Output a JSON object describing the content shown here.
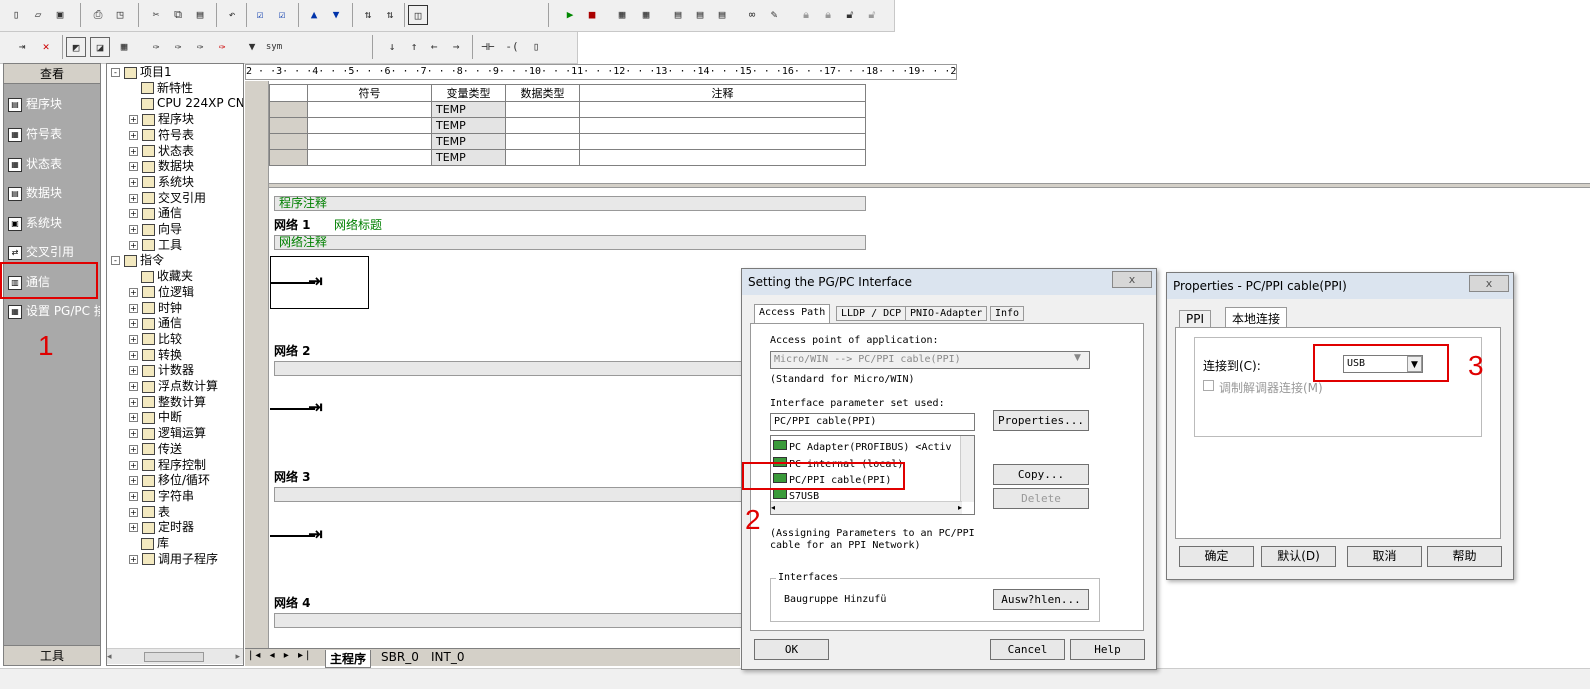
{
  "toolbar1_icons": [
    "new-icon",
    "open-icon",
    "save-icon",
    "print-icon",
    "print-preview-icon",
    "cut-icon",
    "copy-icon",
    "paste-icon",
    "undo-icon",
    "compile-icon",
    "compile-all-icon",
    "upload-icon",
    "download-icon",
    "sort-asc-icon",
    "sort-desc-icon",
    "options-icon",
    "run-icon",
    "stop-icon"
  ],
  "nav": {
    "header": "查看",
    "footer": "工具",
    "items": [
      {
        "label": "程序块",
        "icon": "program-block-icon"
      },
      {
        "label": "符号表",
        "icon": "symbol-table-icon"
      },
      {
        "label": "状态表",
        "icon": "status-table-icon"
      },
      {
        "label": "数据块",
        "icon": "data-block-icon"
      },
      {
        "label": "系统块",
        "icon": "system-block-icon"
      },
      {
        "label": "交叉引用",
        "icon": "cross-ref-icon"
      },
      {
        "label": "通信",
        "icon": "communication-icon"
      },
      {
        "label": "设置 PG/PC 接",
        "icon": "pgpc-icon"
      }
    ]
  },
  "tree": {
    "rows": [
      {
        "label": "项目1",
        "indent": 0,
        "pm": "-"
      },
      {
        "label": "新特性",
        "indent": 2,
        "pm": ""
      },
      {
        "label": "CPU 224XP CN",
        "indent": 2,
        "pm": ""
      },
      {
        "label": "程序块",
        "indent": 1,
        "pm": "+"
      },
      {
        "label": "符号表",
        "indent": 1,
        "pm": "+"
      },
      {
        "label": "状态表",
        "indent": 1,
        "pm": "+"
      },
      {
        "label": "数据块",
        "indent": 1,
        "pm": "+"
      },
      {
        "label": "系统块",
        "indent": 1,
        "pm": "+"
      },
      {
        "label": "交叉引用",
        "indent": 1,
        "pm": "+"
      },
      {
        "label": "通信",
        "indent": 1,
        "pm": "+"
      },
      {
        "label": "向导",
        "indent": 1,
        "pm": "+"
      },
      {
        "label": "工具",
        "indent": 1,
        "pm": "+"
      },
      {
        "label": "指令",
        "indent": 0,
        "pm": "-"
      },
      {
        "label": "收藏夹",
        "indent": 2,
        "pm": ""
      },
      {
        "label": "位逻辑",
        "indent": 1,
        "pm": "+"
      },
      {
        "label": "时钟",
        "indent": 1,
        "pm": "+"
      },
      {
        "label": "通信",
        "indent": 1,
        "pm": "+"
      },
      {
        "label": "比较",
        "indent": 1,
        "pm": "+"
      },
      {
        "label": "转换",
        "indent": 1,
        "pm": "+"
      },
      {
        "label": "计数器",
        "indent": 1,
        "pm": "+"
      },
      {
        "label": "浮点数计算",
        "indent": 1,
        "pm": "+"
      },
      {
        "label": "整数计算",
        "indent": 1,
        "pm": "+"
      },
      {
        "label": "中断",
        "indent": 1,
        "pm": "+"
      },
      {
        "label": "逻辑运算",
        "indent": 1,
        "pm": "+"
      },
      {
        "label": "传送",
        "indent": 1,
        "pm": "+"
      },
      {
        "label": "程序控制",
        "indent": 1,
        "pm": "+"
      },
      {
        "label": "移位/循环",
        "indent": 1,
        "pm": "+"
      },
      {
        "label": "字符串",
        "indent": 1,
        "pm": "+"
      },
      {
        "label": "表",
        "indent": 1,
        "pm": "+"
      },
      {
        "label": "定时器",
        "indent": 1,
        "pm": "+"
      },
      {
        "label": "库",
        "indent": 2,
        "pm": ""
      },
      {
        "label": "调用子程序",
        "indent": 1,
        "pm": "+"
      }
    ]
  },
  "ruler": "2 · ·3· · ·4· · ·5· · ·6· · ·7· · ·8· · ·9· · ·10· · ·11· · ·12· · ·13· · ·14· · ·15· · ·16· · ·17· · ·18· ·  ·19· · ·20· ·",
  "var_table": {
    "headers": [
      "符号",
      "变量类型",
      "数据类型",
      "注释"
    ],
    "rows": [
      [
        "",
        "TEMP",
        "",
        ""
      ],
      [
        "",
        "TEMP",
        "",
        ""
      ],
      [
        "",
        "TEMP",
        "",
        ""
      ],
      [
        "",
        "TEMP",
        "",
        ""
      ]
    ]
  },
  "editor": {
    "program_comment": "程序注释",
    "network1": "网络 1",
    "network_title": "网络标题",
    "network_comment": "网络注释",
    "network2": "网络 2",
    "network3": "网络 3",
    "network4": "网络 4"
  },
  "bottom_tabs": [
    "主程序",
    "SBR_0",
    "INT_0"
  ],
  "pgpc": {
    "title": "Setting the PG/PC Interface",
    "close": "x",
    "tabs": [
      "Access Path",
      "LLDP / DCP",
      "PNIO-Adapter",
      "Info"
    ],
    "ap_label": "Access point of application:",
    "ap_value": "Micro/WIN      --> PC/PPI cable(PPI)",
    "ap_note": "(Standard for Micro/WIN)",
    "ips_label": "Interface parameter set used:",
    "ips_value": "PC/PPI cable(PPI)",
    "properties": "Properties...",
    "list": [
      "PC Adapter(PROFIBUS)  <Activ",
      "PC internal (local)",
      "PC/PPI cable(PPI)",
      "S7USB"
    ],
    "copy": "Copy...",
    "delete": "Delete",
    "note": "(Assigning Parameters to an PC/PPI\ncable for an PPI Network)",
    "interfaces": "Interfaces",
    "iface_text": "Baugruppe Hinzufü",
    "select": "Ausw?hlen...",
    "ok": "OK",
    "cancel": "Cancel",
    "help": "Help"
  },
  "props": {
    "title": "Properties - PC/PPI cable(PPI)",
    "close": "x",
    "tabs": [
      "PPI",
      "本地连接"
    ],
    "connect_label": "连接到(C):",
    "connect_value": "USB",
    "modem_label": "调制解调器连接(M)",
    "ok": "确定",
    "default": "默认(D)",
    "cancel": "取消",
    "help": "帮助"
  },
  "annotations": [
    "1",
    "2",
    "3"
  ],
  "colors": {
    "red": "#e00000",
    "comment_green": "#008000"
  }
}
